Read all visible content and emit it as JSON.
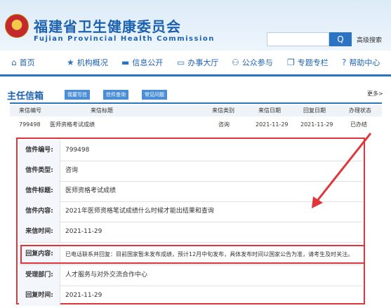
{
  "header": {
    "title_cn": "福建省卫生健康委员会",
    "title_en": "Fujian Provincial Health Commission",
    "search_button": "Q",
    "advanced_search": "高级搜索"
  },
  "nav": [
    {
      "label": "首页",
      "icon": "home-icon",
      "glyph": "⌂"
    },
    {
      "label": "机构概况",
      "icon": "star-icon",
      "glyph": "★"
    },
    {
      "label": "信息公开",
      "icon": "folder-icon",
      "glyph": "▬"
    },
    {
      "label": "办事大厅",
      "icon": "monitor-icon",
      "glyph": "▭"
    },
    {
      "label": "公众参与",
      "icon": "people-icon",
      "glyph": "⚇"
    },
    {
      "label": "专题专栏",
      "icon": "topic-icon",
      "glyph": "❐"
    },
    {
      "label": "帮助中心",
      "icon": "help-icon",
      "glyph": "?"
    }
  ],
  "mailbox": {
    "title": "主任信箱",
    "tabs": [
      "我要写信",
      "信件查询",
      "常见问题"
    ],
    "more": "更多>"
  },
  "table": {
    "headers": [
      "来信编号",
      "来信标题",
      "来信类别",
      "来信日期",
      "回复日期",
      "办理状态"
    ],
    "row": [
      "799498",
      "医师资格考试成绩",
      "咨询",
      "2021-11-29",
      "2021-11-29",
      "已办结"
    ]
  },
  "detail": [
    {
      "label": "信件编号:",
      "value": "799498"
    },
    {
      "label": "信件类型:",
      "value": "咨询"
    },
    {
      "label": "信件标题:",
      "value": "医师资格考试成绩"
    },
    {
      "label": "信件内容:",
      "value": "2021年医师资格笔试成绩什么时候才能出结果和查询"
    },
    {
      "label": "来信时间:",
      "value": "2021-11-29"
    },
    {
      "label": "回复内容:",
      "value": "已电话联系并回复：目前国家暂未发布成绩，预计12月中旬发布，具体发布时间以国家公告为准，请考生及时关注。"
    },
    {
      "label": "受理部门:",
      "value": "人才服务与对外交流合作中心"
    },
    {
      "label": "回复时间:",
      "value": "2021-11-29"
    }
  ],
  "colors": {
    "brand": "#1d62b0",
    "accent": "#e2353b"
  }
}
